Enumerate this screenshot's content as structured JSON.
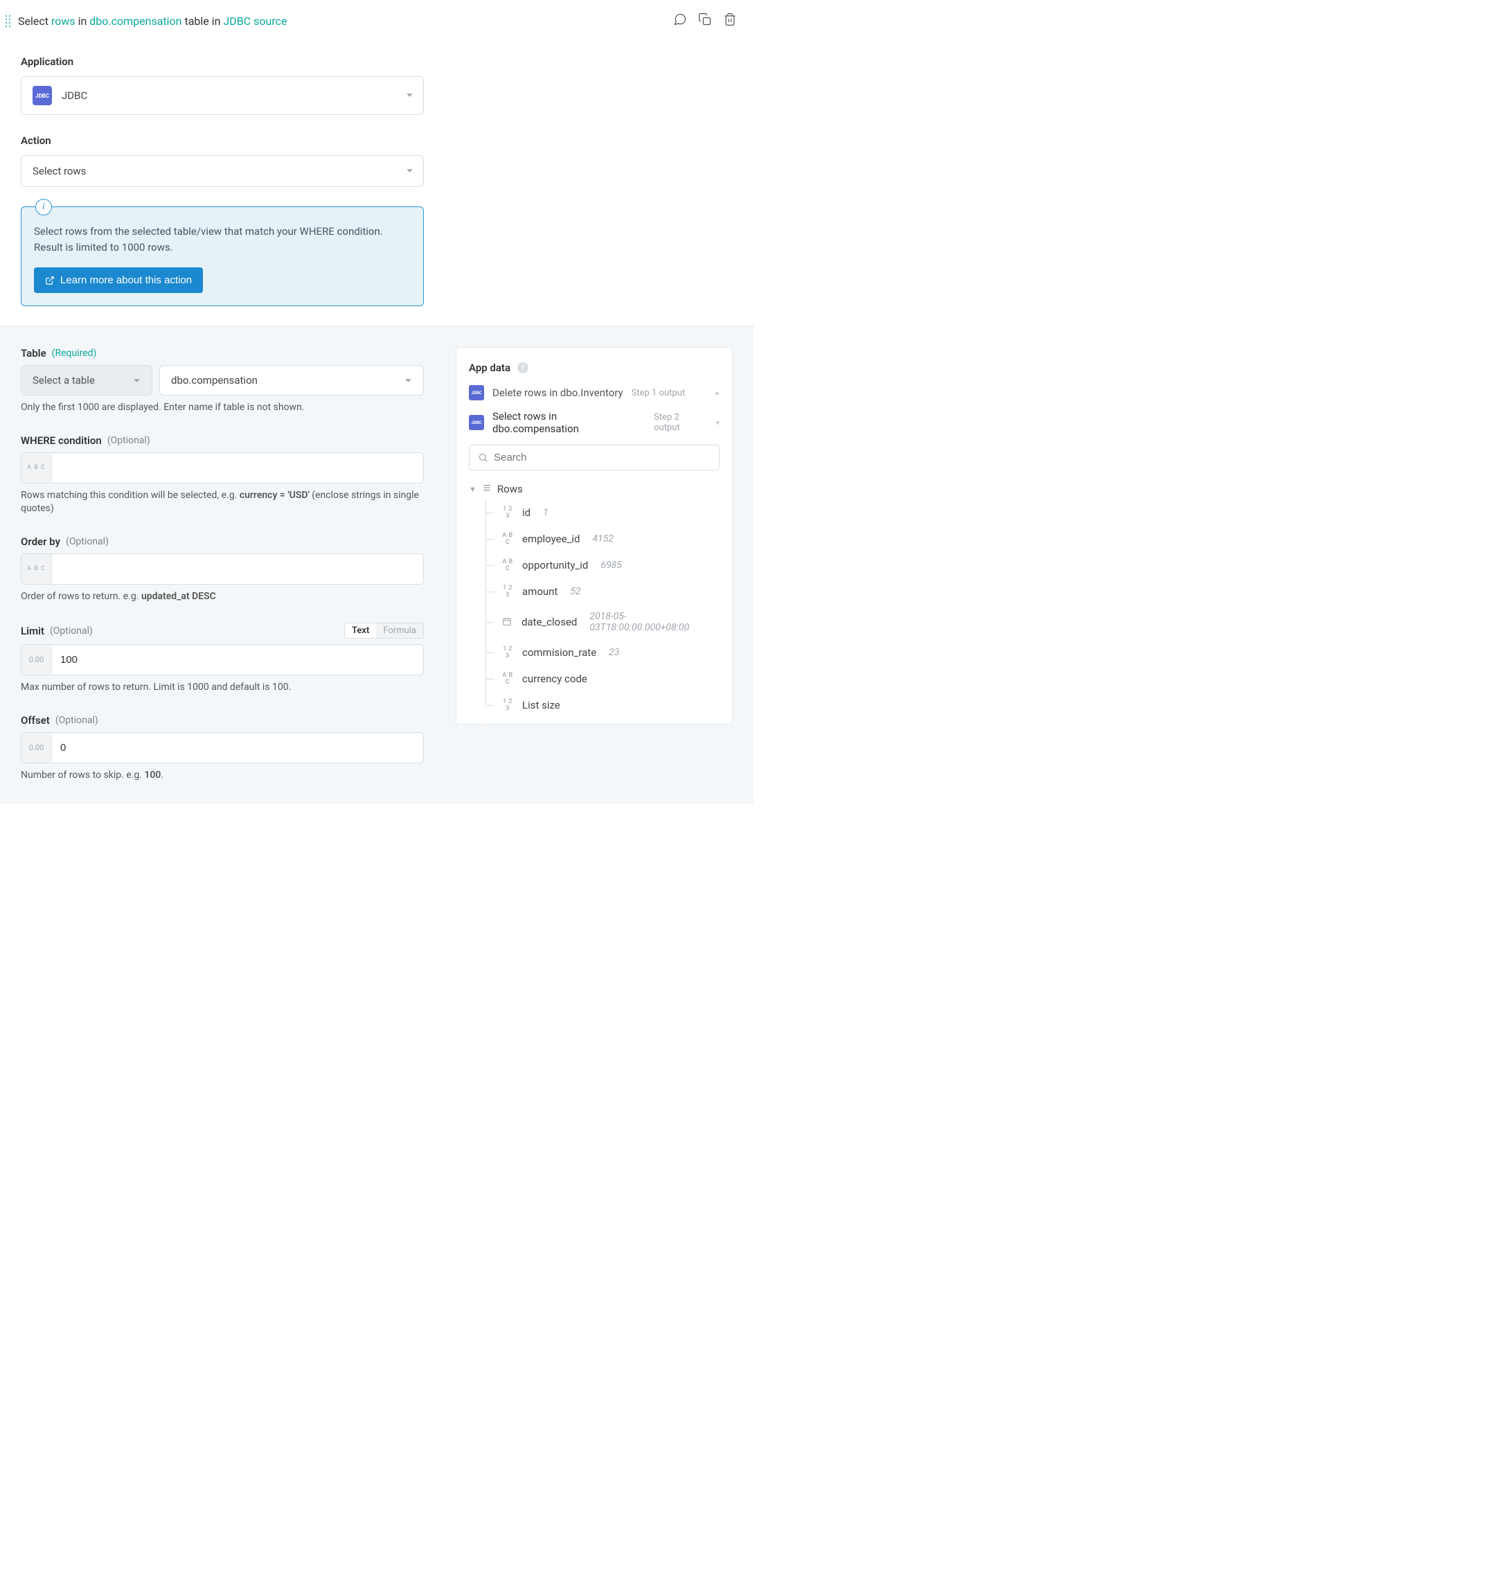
{
  "header": {
    "prefix": "Select ",
    "rows": "rows",
    "mid1": " in ",
    "table": "dbo.compensation",
    "mid2": " table in ",
    "source": "JDBC source"
  },
  "application": {
    "label": "Application",
    "value": "JDBC",
    "badge": "JDBC"
  },
  "action": {
    "label": "Action",
    "value": "Select rows"
  },
  "info": {
    "text": "Select rows from the selected table/view that match your WHERE condition. Result is limited to 1000 rows.",
    "button": "Learn more about this action"
  },
  "table": {
    "label": "Table",
    "req": "(Required)",
    "mode": "Select a table",
    "value": "dbo.compensation",
    "help": "Only the first 1000 are displayed. Enter name if table is not shown."
  },
  "where": {
    "label": "WHERE condition",
    "opt": "(Optional)",
    "prefix": "A B C",
    "value": "",
    "help_pre": "Rows matching this condition will be selected, e.g. ",
    "help_bold": "currency = 'USD'",
    "help_post": " (enclose strings in single quotes)"
  },
  "orderby": {
    "label": "Order by",
    "opt": "(Optional)",
    "prefix": "A B C",
    "value": "",
    "help_pre": "Order of rows to return. e.g. ",
    "help_bold": "updated_at DESC"
  },
  "limit": {
    "label": "Limit",
    "opt": "(Optional)",
    "toggle_text": "Text",
    "toggle_formula": "Formula",
    "prefix": "0.00",
    "value": "100",
    "help": "Max number of rows to return. Limit is 1000 and default is 100."
  },
  "offset": {
    "label": "Offset",
    "opt": "(Optional)",
    "prefix": "0.00",
    "value": "0",
    "help_pre": "Number of rows to skip. e.g. ",
    "help_bold": "100",
    "help_post": "."
  },
  "appdata": {
    "title": "App data",
    "outputs": [
      {
        "badge": "JDBC",
        "text": "Delete rows in dbo.Inventory",
        "step": "Step 1 output",
        "arrow": "▸"
      },
      {
        "badge": "JDBC",
        "text": "Select rows in dbo.compensation",
        "step": "Step 2 output",
        "arrow": "▾"
      }
    ],
    "search_placeholder": "Search",
    "root": "Rows",
    "fields": [
      {
        "type": "123",
        "name": "id",
        "val": "1"
      },
      {
        "type": "ABC",
        "name": "employee_id",
        "val": "4152"
      },
      {
        "type": "ABC",
        "name": "opportunity_id",
        "val": "6985"
      },
      {
        "type": "123",
        "name": "amount",
        "val": "52"
      },
      {
        "type": "CAL",
        "name": "date_closed",
        "val": "2018-05-03T18:00:00.000+08:00"
      },
      {
        "type": "123",
        "name": "commision_rate",
        "val": "23"
      },
      {
        "type": "ABC",
        "name": "currency code",
        "val": ""
      },
      {
        "type": "123",
        "name": "List size",
        "val": ""
      }
    ]
  }
}
